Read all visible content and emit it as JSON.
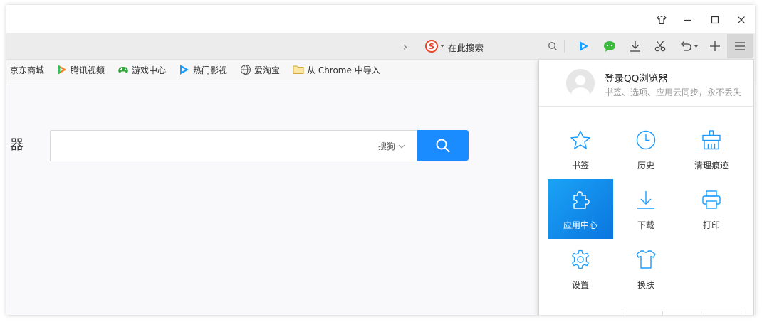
{
  "window_controls": {
    "skin": "shirt-icon",
    "minimize": "minimize-icon",
    "maximize": "maximize-icon",
    "close": "close-icon"
  },
  "toolbar": {
    "forward_chevron": "›",
    "search_placeholder": "在此搜索",
    "engine_icon": "sogou-icon",
    "icons": [
      "search-icon",
      "video-icon",
      "wechat-icon",
      "download-icon",
      "scissors-icon",
      "undo-icon",
      "add-icon",
      "menu-icon"
    ]
  },
  "bookmarks": [
    {
      "label": "京东商城",
      "icon": ""
    },
    {
      "label": "腾讯视频",
      "icon": "tencent-video-icon"
    },
    {
      "label": "游戏中心",
      "icon": "gamepad-icon"
    },
    {
      "label": "热门影视",
      "icon": "video-icon"
    },
    {
      "label": "爱淘宝",
      "icon": "globe-icon"
    },
    {
      "label": "从 Chrome 中导入",
      "icon": "folder-icon"
    }
  ],
  "content": {
    "left_fragment": "器",
    "engine_selector": "搜狗"
  },
  "menu": {
    "login_title": "登录QQ浏览器",
    "login_subtitle": "书签、选项、应用云同步，永不丢失",
    "items": [
      {
        "label": "书签",
        "icon": "star-icon"
      },
      {
        "label": "历史",
        "icon": "clock-icon"
      },
      {
        "label": "清理痕迹",
        "icon": "broom-icon"
      },
      {
        "label": "应用中心",
        "icon": "puzzle-icon",
        "active": true
      },
      {
        "label": "下载",
        "icon": "download-icon"
      },
      {
        "label": "打印",
        "icon": "printer-icon"
      },
      {
        "label": "设置",
        "icon": "gear-icon"
      },
      {
        "label": "换肤",
        "icon": "shirt-icon"
      }
    ]
  },
  "colors": {
    "accent": "#1a8cff",
    "active_gradient_start": "#1aa3f5",
    "active_gradient_end": "#0b76e0",
    "icon_blue": "#1a9cff"
  }
}
